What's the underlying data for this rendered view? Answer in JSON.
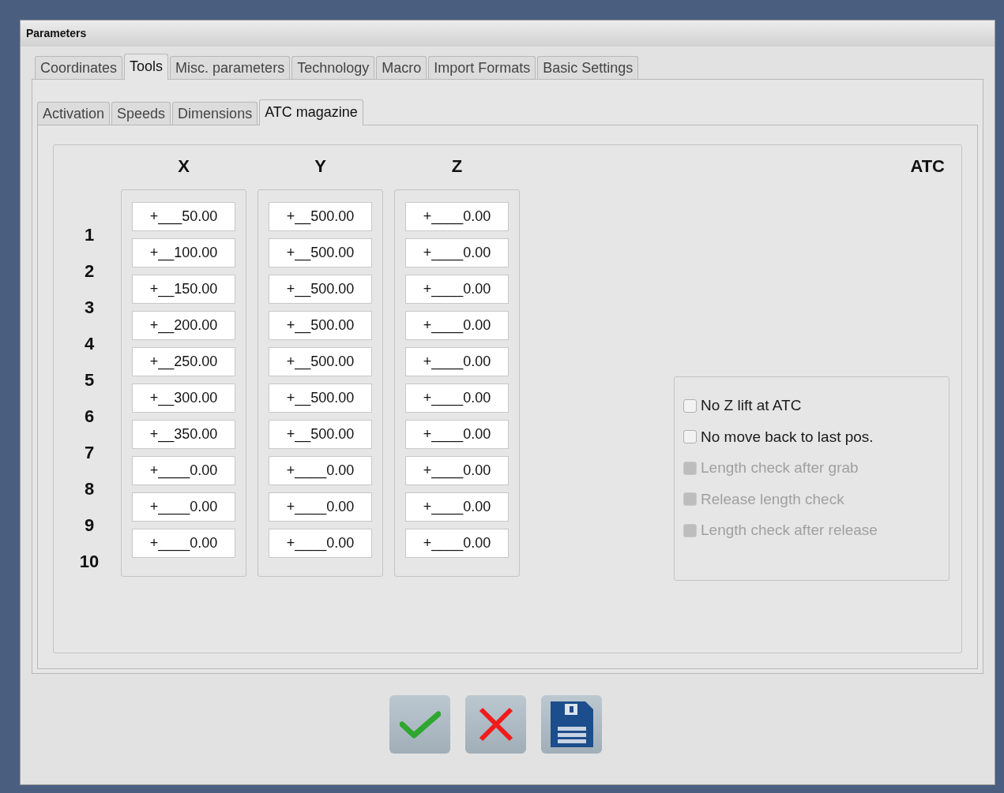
{
  "window": {
    "title": "Parameters"
  },
  "tabs": [
    {
      "label": "Coordinates",
      "selected": false
    },
    {
      "label": "Tools",
      "selected": true
    },
    {
      "label": "Misc. parameters",
      "selected": false
    },
    {
      "label": "Technology",
      "selected": false
    },
    {
      "label": "Macro",
      "selected": false
    },
    {
      "label": "Import Formats",
      "selected": false
    },
    {
      "label": "Basic Settings",
      "selected": false
    }
  ],
  "subtabs": [
    {
      "label": "Activation",
      "selected": false
    },
    {
      "label": "Speeds",
      "selected": false
    },
    {
      "label": "Dimensions",
      "selected": false
    },
    {
      "label": "ATC magazine",
      "selected": true
    }
  ],
  "columns": [
    "X",
    "Y",
    "Z"
  ],
  "atc_heading": "ATC",
  "rows": [
    {
      "label": "1",
      "values": [
        "+___50.00",
        "+__500.00",
        "+____0.00"
      ]
    },
    {
      "label": "2",
      "values": [
        "+__100.00",
        "+__500.00",
        "+____0.00"
      ]
    },
    {
      "label": "3",
      "values": [
        "+__150.00",
        "+__500.00",
        "+____0.00"
      ]
    },
    {
      "label": "4",
      "values": [
        "+__200.00",
        "+__500.00",
        "+____0.00"
      ]
    },
    {
      "label": "5",
      "values": [
        "+__250.00",
        "+__500.00",
        "+____0.00"
      ]
    },
    {
      "label": "6",
      "values": [
        "+__300.00",
        "+__500.00",
        "+____0.00"
      ]
    },
    {
      "label": "7",
      "values": [
        "+__350.00",
        "+__500.00",
        "+____0.00"
      ]
    },
    {
      "label": "8",
      "values": [
        "+____0.00",
        "+____0.00",
        "+____0.00"
      ]
    },
    {
      "label": "9",
      "values": [
        "+____0.00",
        "+____0.00",
        "+____0.00"
      ]
    },
    {
      "label": "10",
      "values": [
        "+____0.00",
        "+____0.00",
        "+____0.00"
      ]
    }
  ],
  "options": [
    {
      "label": "No Z lift at ATC",
      "checked": false,
      "disabled": false
    },
    {
      "label": "No move back to last pos.",
      "checked": false,
      "disabled": false
    },
    {
      "label": "Length check after grab",
      "checked": false,
      "disabled": true
    },
    {
      "label": "Release length check",
      "checked": false,
      "disabled": true
    },
    {
      "label": "Length check after release",
      "checked": false,
      "disabled": true
    }
  ],
  "buttons": [
    {
      "kind": "confirm"
    },
    {
      "kind": "cancel"
    },
    {
      "kind": "save"
    }
  ]
}
